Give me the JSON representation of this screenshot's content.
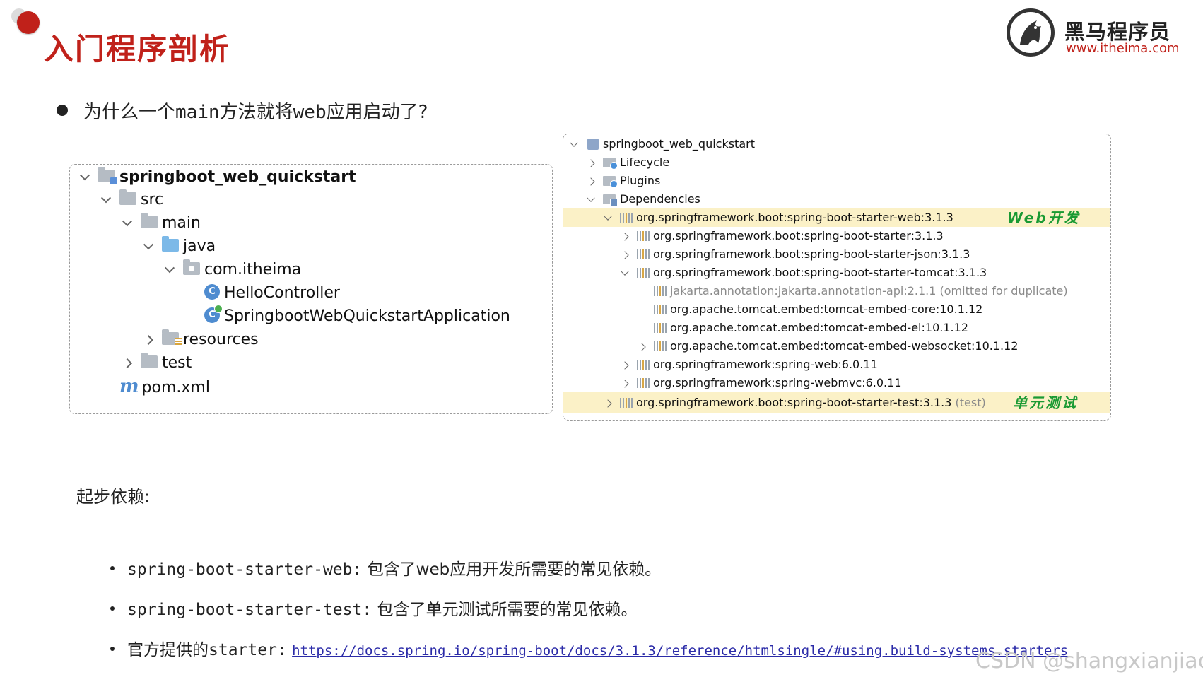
{
  "slide": {
    "title": "入门程序剖析",
    "question_pre": "为什么一个",
    "question_mono1": "main",
    "question_mid": "方法就将",
    "question_mono2": "web",
    "question_post": "应用启动了?"
  },
  "logo": {
    "cn": "黑马程序员",
    "en": "www.itheima.com"
  },
  "project_tree": {
    "root": "springboot_web_quickstart",
    "src": "src",
    "main": "main",
    "java": "java",
    "package": "com.itheima",
    "class1": "HelloController",
    "class2": "SpringbootWebQuickstartApplication",
    "resources": "resources",
    "test": "test",
    "pom": "pom.xml",
    "class_letter": "C"
  },
  "maven_tree": {
    "root": "springboot_web_quickstart",
    "lifecycle": "Lifecycle",
    "plugins": "Plugins",
    "dependencies": "Dependencies",
    "dep_web": "org.springframework.boot:spring-boot-starter-web:3.1.3",
    "dep_starter": "org.springframework.boot:spring-boot-starter:3.1.3",
    "dep_json": "org.springframework.boot:spring-boot-starter-json:3.1.3",
    "dep_tomcat": "org.springframework.boot:spring-boot-starter-tomcat:3.1.3",
    "dep_jakarta": "jakarta.annotation:jakarta.annotation-api:2.1.1 (omitted for duplicate)",
    "dep_tomcat_core": "org.apache.tomcat.embed:tomcat-embed-core:10.1.12",
    "dep_tomcat_el": "org.apache.tomcat.embed:tomcat-embed-el:10.1.12",
    "dep_tomcat_ws": "org.apache.tomcat.embed:tomcat-embed-websocket:10.1.12",
    "dep_spring_web": "org.springframework:spring-web:6.0.11",
    "dep_spring_webmvc": "org.springframework:spring-webmvc:6.0.11",
    "dep_test": "org.springframework.boot:spring-boot-starter-test:3.1.3",
    "dep_test_scope": "(test)",
    "annot_web": "Web开发",
    "annot_test": "单元测试"
  },
  "bottom": {
    "heading": "起步依赖:",
    "item1_code": "spring-boot-starter-web:",
    "item1_text": " 包含了web应用开发所需要的常见依赖。",
    "item2_code": "spring-boot-starter-test:",
    "item2_text": " 包含了单元测试所需要的常见依赖。",
    "item3_pre": "官方提供的",
    "item3_code": "starter:",
    "item3_link": "https://docs.spring.io/spring-boot/docs/3.1.3/reference/htmlsingle/#using.build-systems.starters"
  },
  "watermark": "CSDN @shangxianjiao",
  "colors": {
    "brand_red": "#c0211a",
    "highlight": "#fbf1c7",
    "annotation_green": "#1a9a33"
  },
  "icons": [
    "folder-icon",
    "class-icon",
    "maven-icon",
    "library-icon",
    "chevron-down-icon",
    "chevron-right-icon"
  ]
}
